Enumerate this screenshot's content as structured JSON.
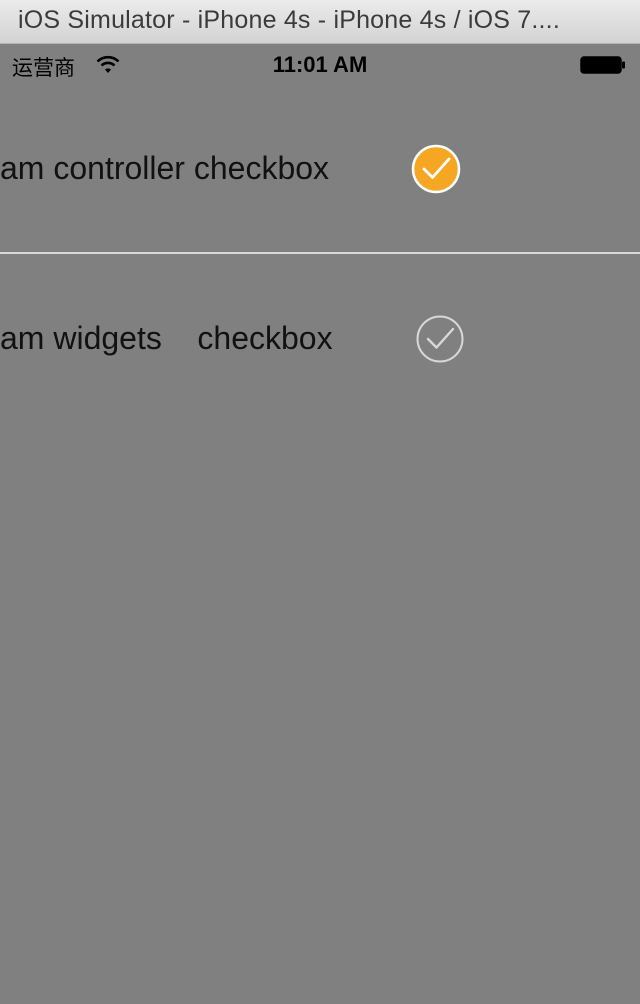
{
  "window": {
    "title": "iOS Simulator - iPhone 4s - iPhone 4s / iOS 7...."
  },
  "status_bar": {
    "carrier": "运营商",
    "time": "11:01 AM",
    "wifi_icon": "wifi-icon",
    "battery_icon": "battery-icon"
  },
  "rows": [
    {
      "label": "am controller checkbox",
      "checked": true,
      "checkbox_color": "#f5a623",
      "icon": "checkmark-circle-icon"
    },
    {
      "label": "am widgets    checkbox",
      "checked": false,
      "checkbox_color": "#d8d8d8",
      "icon": "checkmark-circle-outline-icon"
    }
  ],
  "colors": {
    "background": "#808080",
    "divider": "#d8d8d8",
    "accent": "#f5a623"
  }
}
